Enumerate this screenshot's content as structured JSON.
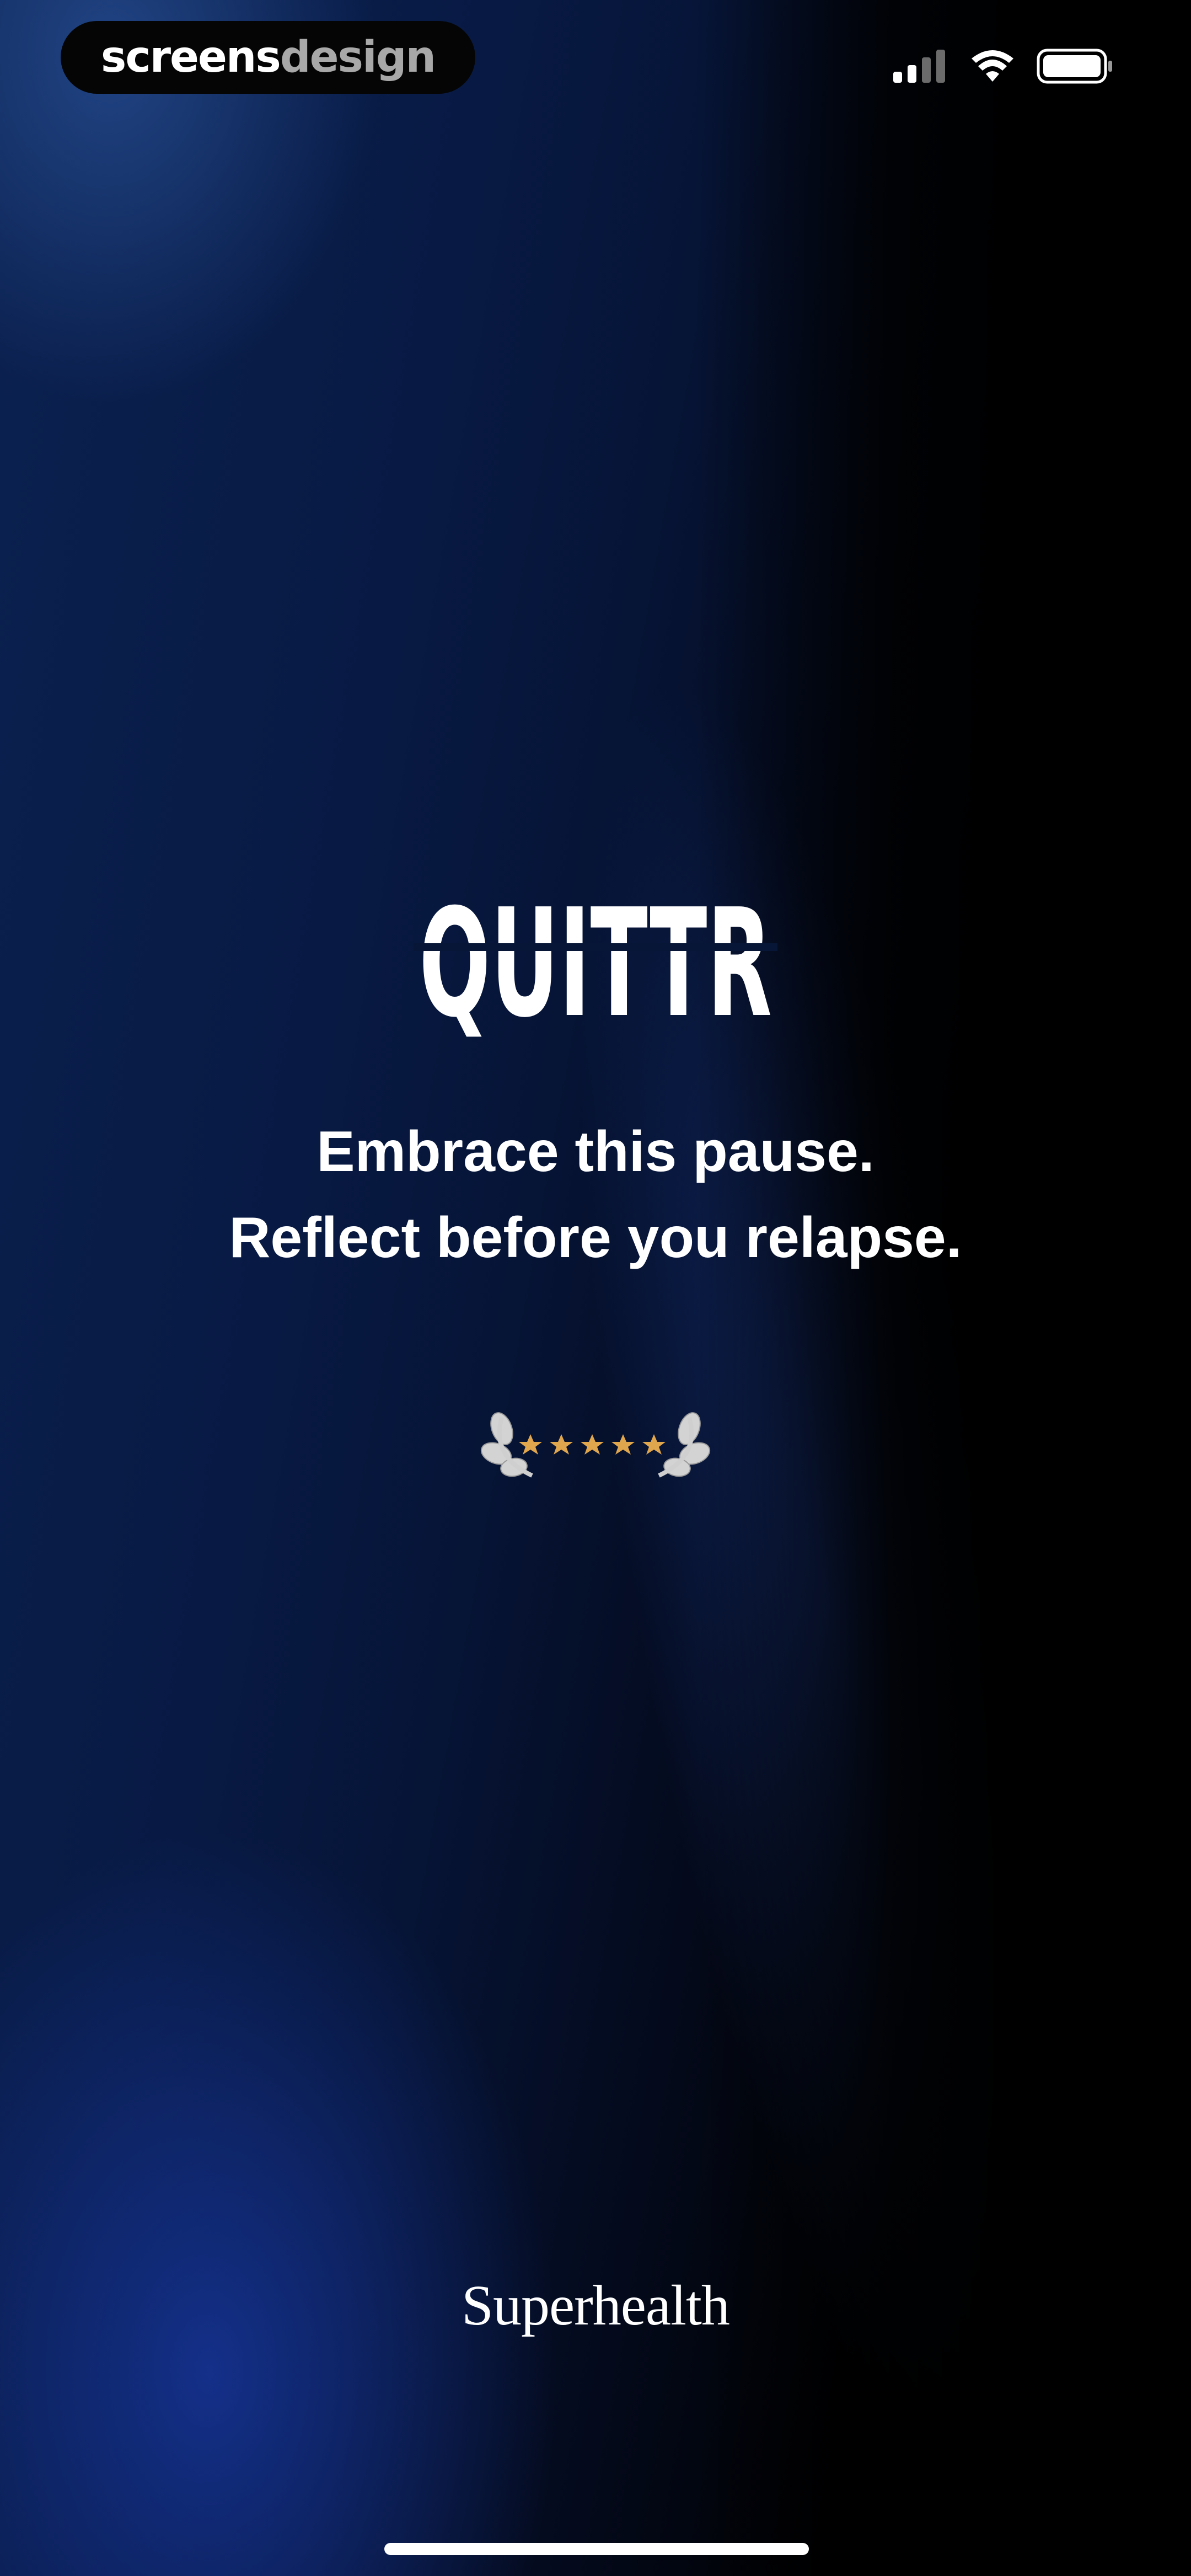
{
  "status_bar": {
    "brand_part1": "screens",
    "brand_part2": "design",
    "icons": [
      "cellular-signal-icon",
      "wifi-icon",
      "battery-icon"
    ]
  },
  "main": {
    "logo_text": "QUITTR",
    "tagline_line1": "Embrace this pause.",
    "tagline_line2": "Reflect before you relapse.",
    "rating_stars": 5,
    "rating_icon": "laurel-five-stars-icon"
  },
  "footer": {
    "sponsor": "Superhealth"
  },
  "colors": {
    "background_blue": "#0b2150",
    "text": "#ffffff",
    "star": "#e0a64d",
    "laurel": "#c8c8c8"
  }
}
